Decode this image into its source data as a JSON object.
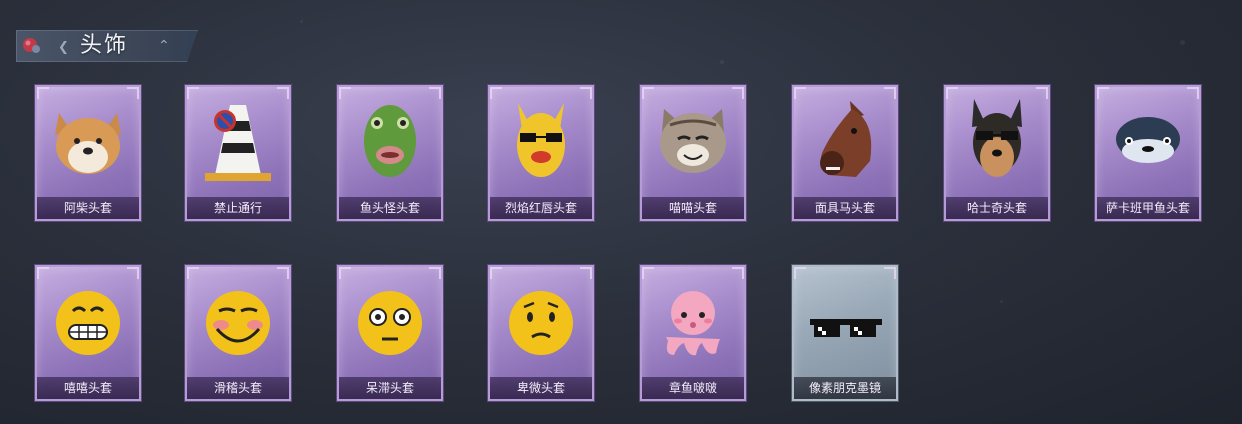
{
  "section": {
    "title": "头饰",
    "icon": "pin-icon"
  },
  "colors": {
    "epic_frame": "#a88dcc",
    "rare_frame": "#9aa9b8",
    "background": "#2b303c"
  },
  "items": [
    {
      "label": "阿柴头套",
      "icon": "shiba-dog-head-icon",
      "rarity": "epic"
    },
    {
      "label": "禁止通行",
      "icon": "traffic-cone-icon",
      "rarity": "epic"
    },
    {
      "label": "鱼头怪头套",
      "icon": "fish-head-icon",
      "rarity": "epic"
    },
    {
      "label": "烈焰红唇头套",
      "icon": "yellow-creature-lips-icon",
      "rarity": "epic"
    },
    {
      "label": "喵喵头套",
      "icon": "cat-head-icon",
      "rarity": "epic"
    },
    {
      "label": "面具马头套",
      "icon": "horse-head-icon",
      "rarity": "epic"
    },
    {
      "label": "哈士奇头套",
      "icon": "husky-head-icon",
      "rarity": "epic"
    },
    {
      "label": "萨卡班甲鱼头套",
      "icon": "fish-creature-icon",
      "rarity": "epic"
    },
    {
      "label": "嘻嘻头套",
      "icon": "grin-emoji-icon",
      "rarity": "epic"
    },
    {
      "label": "滑稽头套",
      "icon": "funny-emoji-icon",
      "rarity": "epic"
    },
    {
      "label": "呆滞头套",
      "icon": "dazed-emoji-icon",
      "rarity": "epic"
    },
    {
      "label": "卑微头套",
      "icon": "timid-emoji-icon",
      "rarity": "epic"
    },
    {
      "label": "章鱼啵啵",
      "icon": "pink-octopus-icon",
      "rarity": "epic"
    },
    {
      "label": "像素朋克墨镜",
      "icon": "pixel-sunglasses-icon",
      "rarity": "rare"
    }
  ]
}
